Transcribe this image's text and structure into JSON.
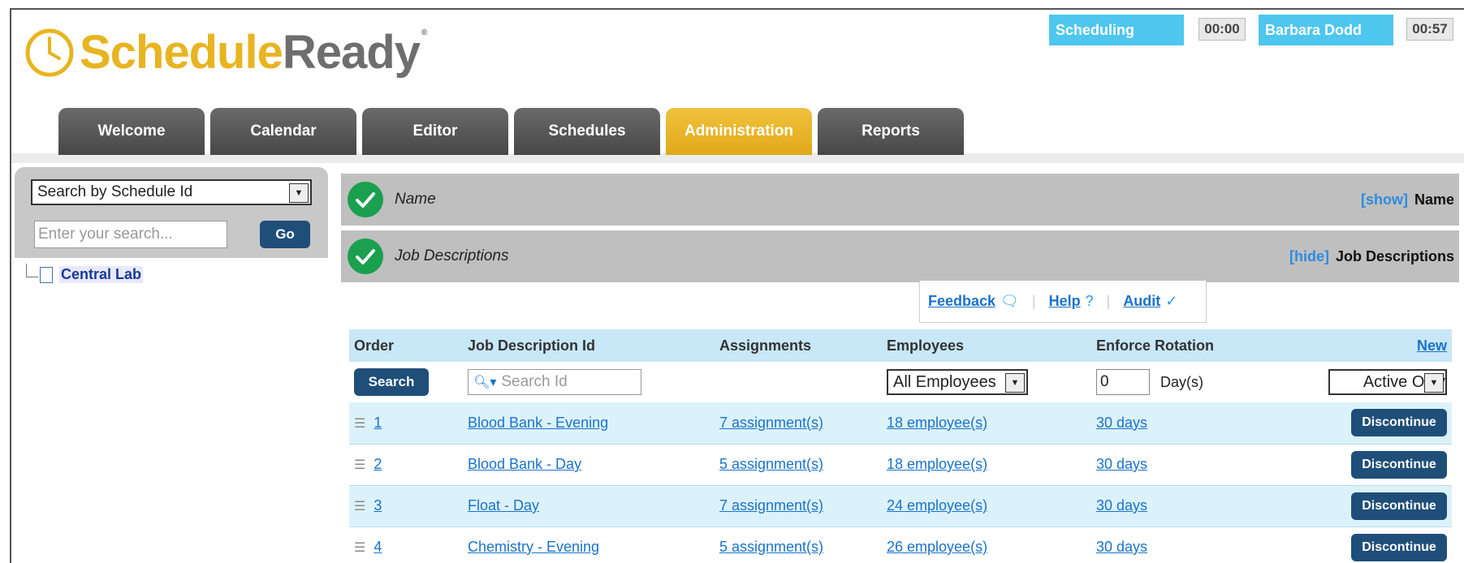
{
  "app": {
    "logo_part1": "Schedule",
    "logo_part2": "Ready",
    "logo_reg": "®",
    "status_label": "Scheduling",
    "status_timer": "00:00",
    "user_name": "Barbara Dodd",
    "user_timer": "00:57",
    "colors": {
      "accent": "#e8b420",
      "status": "#4ec6ee",
      "button": "#1f4e79",
      "check": "#1aa04f"
    }
  },
  "tabs": [
    {
      "label": "Welcome"
    },
    {
      "label": "Calendar"
    },
    {
      "label": "Editor"
    },
    {
      "label": "Schedules"
    },
    {
      "label": "Administration",
      "active": true
    },
    {
      "label": "Reports"
    }
  ],
  "sidebar": {
    "search_type": "Search by Schedule Id",
    "search_placeholder": "Enter your search...",
    "go_label": "Go",
    "tree_item": "Central Lab"
  },
  "sections": [
    {
      "title": "Name",
      "toggle": "[show]",
      "name": "Name"
    },
    {
      "title": "Job Descriptions",
      "toggle": "[hide]",
      "name": "Job Descriptions"
    }
  ],
  "links": {
    "feedback": "Feedback",
    "help": "Help",
    "audit": "Audit",
    "separator": "|"
  },
  "table": {
    "headers": [
      "Order",
      "Job Description Id",
      "Assignments",
      "Employees",
      "Enforce Rotation",
      "New"
    ],
    "search_label": "Search",
    "search_id_placeholder": "Search Id",
    "employees_filter": "All Employees",
    "rotation_value": "0",
    "rotation_unit": "Day(s)",
    "status_filter": "Active Only",
    "discontinue_label": "Discontinue",
    "rows": [
      {
        "order": "1",
        "id": "Blood Bank - Evening",
        "assignments": "7 assignment(s)",
        "employees": "18 employee(s)",
        "rotation": "30 days"
      },
      {
        "order": "2",
        "id": "Blood Bank - Day",
        "assignments": "5 assignment(s)",
        "employees": "18 employee(s)",
        "rotation": "30 days"
      },
      {
        "order": "3",
        "id": "Float - Day",
        "assignments": "7 assignment(s)",
        "employees": "24 employee(s)",
        "rotation": "30 days"
      },
      {
        "order": "4",
        "id": "Chemistry - Evening",
        "assignments": "5 assignment(s)",
        "employees": "26 employee(s)",
        "rotation": "30 days"
      }
    ]
  }
}
